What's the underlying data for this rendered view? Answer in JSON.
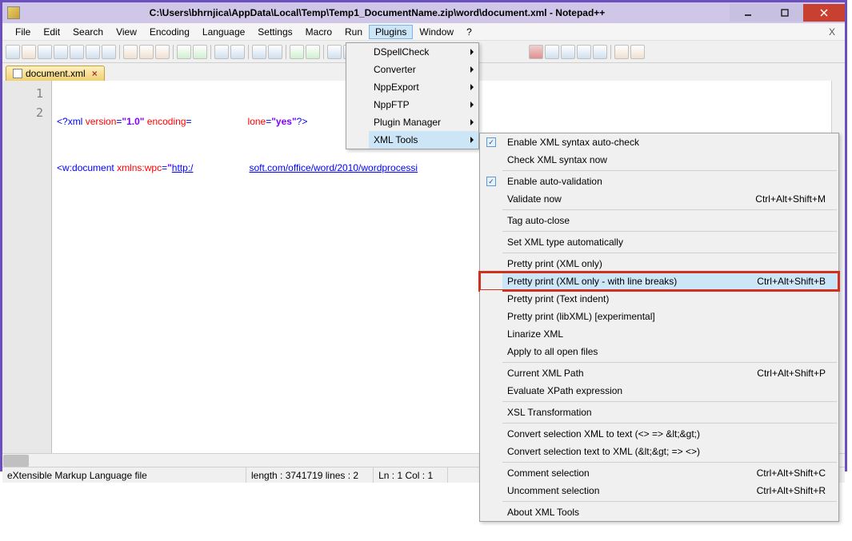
{
  "titlebar": {
    "text": "C:\\Users\\bhrnjica\\AppData\\Local\\Temp\\Temp1_DocumentName.zip\\word\\document.xml - Notepad++"
  },
  "menu": {
    "items": [
      "File",
      "Edit",
      "Search",
      "View",
      "Encoding",
      "Language",
      "Settings",
      "Macro",
      "Run",
      "Plugins",
      "Window",
      "?"
    ],
    "open_index": 9
  },
  "tab": {
    "label": "document.xml"
  },
  "gutter": [
    "1",
    "2"
  ],
  "code": {
    "l1": {
      "a": "<?",
      "b": "xml ",
      "c": "version",
      "d": "=",
      "e": "\"1.0\"",
      "f": " encoding",
      "g": "=",
      "gap": "                     ",
      "h": "lone",
      "i": "=",
      "j": "\"yes\"",
      "k": "?>"
    },
    "l2": {
      "a": "<",
      "b": "w:document ",
      "c": "xmlns:wpc",
      "d": "=",
      "e": "\"",
      "f": "http:/",
      "gap": "                     ",
      "g": "soft.com/office/word/2010/wordprocessi"
    }
  },
  "plugins_submenu": [
    {
      "label": "DSpellCheck",
      "arrow": true
    },
    {
      "label": "Converter",
      "arrow": true
    },
    {
      "label": "NppExport",
      "arrow": true
    },
    {
      "label": "NppFTP",
      "arrow": true
    },
    {
      "label": "Plugin Manager",
      "arrow": true
    },
    {
      "label": "XML Tools",
      "arrow": true,
      "hl": true
    }
  ],
  "xml_submenu": [
    {
      "label": "Enable XML syntax auto-check",
      "check": true
    },
    {
      "label": "Check XML syntax now"
    },
    {
      "sep": true
    },
    {
      "label": "Enable auto-validation",
      "check": true
    },
    {
      "label": "Validate now",
      "shortcut": "Ctrl+Alt+Shift+M"
    },
    {
      "sep": true
    },
    {
      "label": "Tag auto-close"
    },
    {
      "sep": true
    },
    {
      "label": "Set XML type automatically"
    },
    {
      "sep": true
    },
    {
      "label": "Pretty print (XML only)"
    },
    {
      "label": "Pretty print (XML only - with line breaks)",
      "shortcut": "Ctrl+Alt+Shift+B",
      "hl": true,
      "red": true
    },
    {
      "label": "Pretty print (Text indent)"
    },
    {
      "label": "Pretty print (libXML) [experimental]"
    },
    {
      "label": "Linarize XML"
    },
    {
      "label": "Apply to all open files"
    },
    {
      "sep": true
    },
    {
      "label": "Current XML Path",
      "shortcut": "Ctrl+Alt+Shift+P"
    },
    {
      "label": "Evaluate XPath expression"
    },
    {
      "sep": true
    },
    {
      "label": "XSL Transformation"
    },
    {
      "sep": true
    },
    {
      "label": "Convert selection XML to text (<> => &lt;&gt;)"
    },
    {
      "label": "Convert selection text to XML (&lt;&gt; => <>)"
    },
    {
      "sep": true
    },
    {
      "label": "Comment selection",
      "shortcut": "Ctrl+Alt+Shift+C"
    },
    {
      "label": "Uncomment selection",
      "shortcut": "Ctrl+Alt+Shift+R"
    },
    {
      "sep": true
    },
    {
      "label": "About XML Tools"
    }
  ],
  "status": {
    "filetype": "eXtensible Markup Language file",
    "length": "length : 3741719    lines : 2",
    "pos": "Ln : 1    Col : 1"
  }
}
